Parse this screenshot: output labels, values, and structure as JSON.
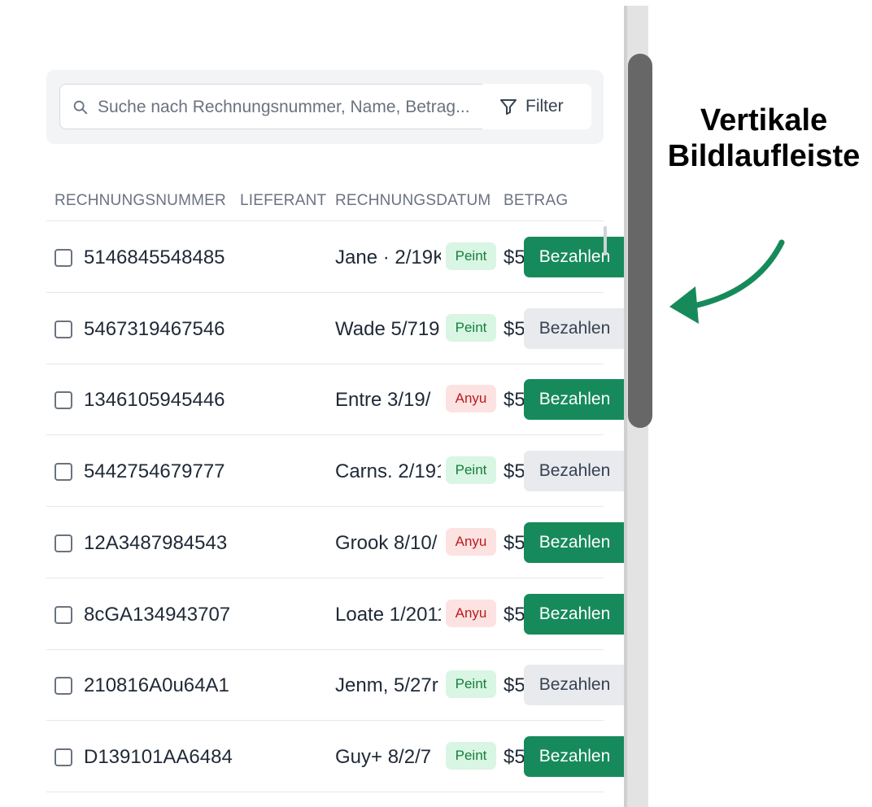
{
  "search": {
    "placeholder": "Suche nach Rechnungsnummer, Name, Betrag..."
  },
  "filter": {
    "label": "Filter"
  },
  "columns": [
    "RECHNUNGSNUMMER",
    "LIEFERANT",
    "RECHNUNGSDATUM",
    "BETRAG"
  ],
  "rows": [
    {
      "invoice": "5146845548485",
      "supplier": "Jane · 2/19K",
      "status": "Peint",
      "status_color": "green",
      "amount": "$5",
      "action": "Bezahlen",
      "action_style": "primary"
    },
    {
      "invoice": "5467319467546",
      "supplier": "Wade 5/719",
      "status": "Peint",
      "status_color": "green",
      "amount": "$5",
      "action": "Bezahlen",
      "action_style": "secondary"
    },
    {
      "invoice": "1346105945446",
      "supplier": "Entre  3/19/",
      "status": "Anyu",
      "status_color": "red",
      "amount": "$5",
      "action": "Bezahlen",
      "action_style": "primary"
    },
    {
      "invoice": "5442754679777",
      "supplier": "Carns. 2/191",
      "status": "Peint",
      "status_color": "green",
      "amount": "$5",
      "action": "Bezahlen",
      "action_style": "secondary"
    },
    {
      "invoice": "12A3487984543",
      "supplier": "Grook 8/10/",
      "status": "Anyu",
      "status_color": "red",
      "amount": "$5",
      "action": "Bezahlen",
      "action_style": "primary"
    },
    {
      "invoice": "8cGA134943707",
      "supplier": "Loate 1/2011",
      "status": "Anyu",
      "status_color": "red",
      "amount": "$5",
      "action": "Bezahlen",
      "action_style": "primary"
    },
    {
      "invoice": "210816A0u64A1",
      "supplier": "Jenm, 5/27r",
      "status": "Peint",
      "status_color": "green",
      "amount": "$5",
      "action": "Bezahlen",
      "action_style": "secondary"
    },
    {
      "invoice": "D139101AA6484",
      "supplier": "Guy+  8/2/7",
      "status": "Peint",
      "status_color": "green",
      "amount": "$5",
      "action": "Bezahlen",
      "action_style": "primary"
    }
  ],
  "callout": {
    "line1": "Vertikale",
    "line2": "Bildlaufleiste"
  },
  "colors": {
    "accent": "#178a5b",
    "badge_green_bg": "#d9f5e3",
    "badge_red_bg": "#fde2e2",
    "scrollbar_thumb": "#676767",
    "arrow": "#178a5b"
  },
  "icons": {
    "search": "search-icon",
    "filter": "filter-icon",
    "arrow": "curved-arrow-icon"
  }
}
